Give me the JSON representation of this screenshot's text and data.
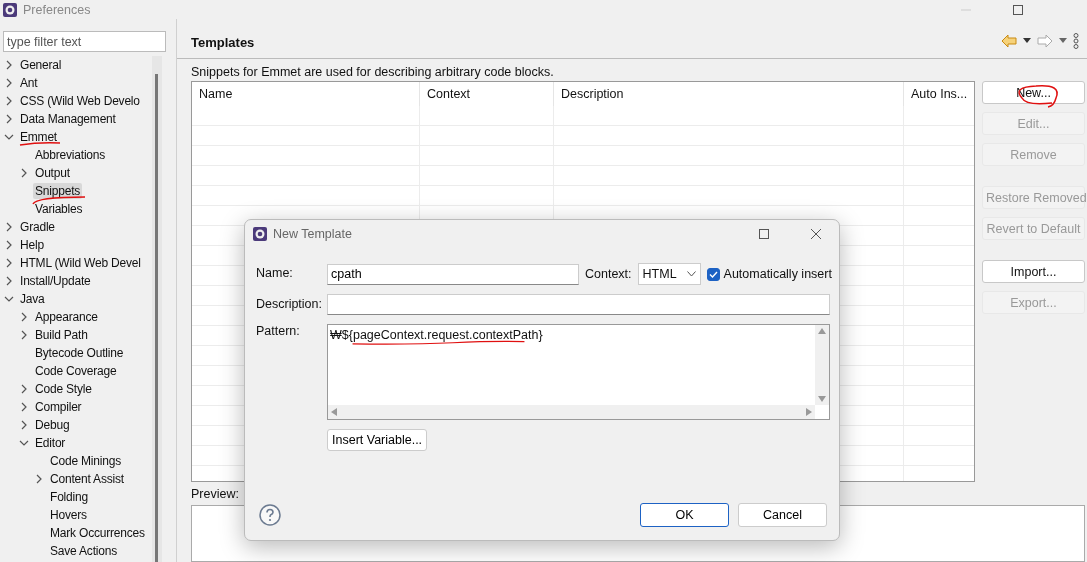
{
  "window": {
    "title": "Preferences",
    "filter": {
      "placeholder": "type filter text"
    }
  },
  "tree": [
    {
      "label": "General",
      "expanded": false
    },
    {
      "label": "Ant",
      "expanded": false
    },
    {
      "label": "CSS (Wild Web Develo",
      "expanded": false
    },
    {
      "label": "Data Management",
      "expanded": false
    },
    {
      "label": "Emmet",
      "expanded": true,
      "children": [
        {
          "label": "Abbreviations",
          "selected": false
        },
        {
          "label": "Output",
          "expanded": false,
          "selected": false
        },
        {
          "label": "Snippets",
          "selected": true
        },
        {
          "label": "Variables",
          "selected": false
        }
      ]
    },
    {
      "label": "Gradle",
      "expanded": false
    },
    {
      "label": "Help",
      "expanded": false
    },
    {
      "label": "HTML (Wild Web Devel",
      "expanded": false
    },
    {
      "label": "Install/Update",
      "expanded": false
    },
    {
      "label": "Java",
      "expanded": true,
      "children": [
        {
          "label": "Appearance",
          "expanded": false
        },
        {
          "label": "Build Path",
          "expanded": false
        },
        {
          "label": "Bytecode Outline"
        },
        {
          "label": "Code Coverage"
        },
        {
          "label": "Code Style",
          "expanded": false
        },
        {
          "label": "Compiler",
          "expanded": false
        },
        {
          "label": "Debug",
          "expanded": false
        },
        {
          "label": "Editor",
          "expanded": true,
          "children": [
            {
              "label": "Code Minings"
            },
            {
              "label": "Content Assist",
              "expanded": false
            },
            {
              "label": "Folding"
            },
            {
              "label": "Hovers"
            },
            {
              "label": "Mark Occurrences"
            },
            {
              "label": "Save Actions"
            }
          ]
        }
      ]
    }
  ],
  "page": {
    "title": "Templates",
    "description": "Snippets for Emmet are used for describing arbitrary code blocks.",
    "preview_label": "Preview:"
  },
  "table": {
    "columns": [
      "Name",
      "Context",
      "Description",
      "Auto Ins..."
    ]
  },
  "buttons": [
    {
      "label": "New...",
      "disabled": false
    },
    {
      "label": "Edit...",
      "disabled": true
    },
    {
      "label": "Remove",
      "disabled": true
    },
    {
      "label": "Restore Removed",
      "disabled": true
    },
    {
      "label": "Revert to Default",
      "disabled": true
    },
    {
      "label": "Import...",
      "disabled": false
    },
    {
      "label": "Export...",
      "disabled": true
    }
  ],
  "dialog": {
    "title": "New Template",
    "name_label": "Name:",
    "name": "cpath",
    "context_label": "Context:",
    "context": "HTML",
    "auto_insert": {
      "label": "Automatically insert",
      "checked": true
    },
    "description_label": "Description:",
    "pattern_label": "Pattern:",
    "pattern": "₩${pageContext.request.contextPath}",
    "insert_variable": "Insert Variable...",
    "ok": "OK",
    "cancel": "Cancel"
  }
}
